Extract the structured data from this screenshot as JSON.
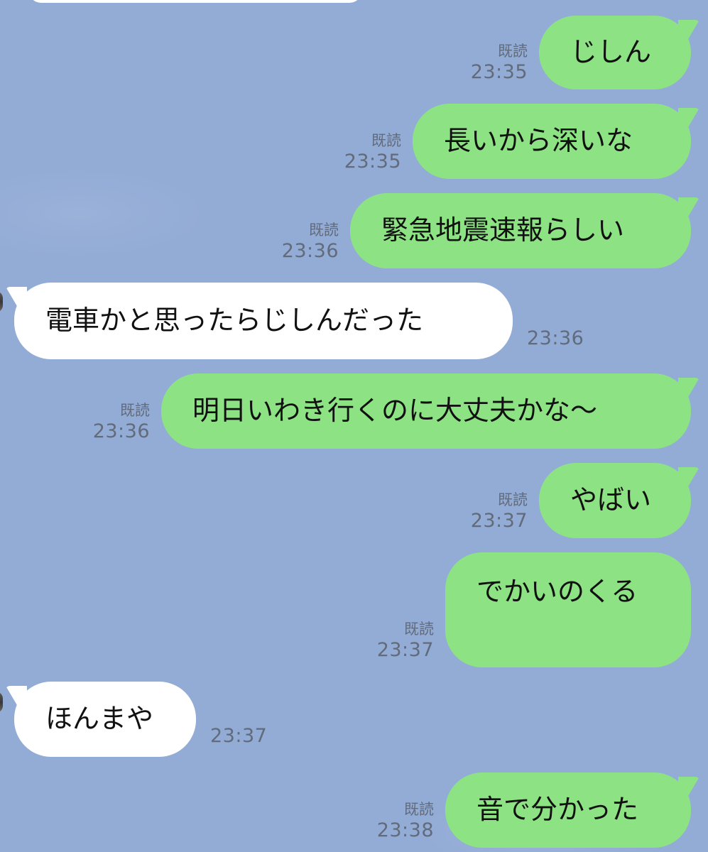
{
  "chat": {
    "read_label": "既読",
    "messages": [
      {
        "type": "sent",
        "text": "じしん",
        "time": "23:35"
      },
      {
        "type": "sent",
        "text": "長いから深いな",
        "time": "23:35"
      },
      {
        "type": "sent",
        "text": "緊急地震速報らしい",
        "time": "23:36"
      },
      {
        "type": "received",
        "text": "電車かと思ったらじしんだった",
        "time": "23:36"
      },
      {
        "type": "sent",
        "text": "明日いわき行くのに大丈夫かな〜",
        "time": "23:36"
      },
      {
        "type": "sent",
        "text": "やばい",
        "time": "23:37"
      },
      {
        "type": "sent",
        "text": "でかいのくる",
        "time": "23:37"
      },
      {
        "type": "received",
        "text": "ほんまや",
        "time": "23:37"
      },
      {
        "type": "sent",
        "text": "音で分かった",
        "time": "23:38"
      }
    ]
  },
  "colors": {
    "background": "#93acd6",
    "sent_bubble": "#8de383",
    "received_bubble": "#ffffff",
    "meta_text": "#616b7b"
  }
}
